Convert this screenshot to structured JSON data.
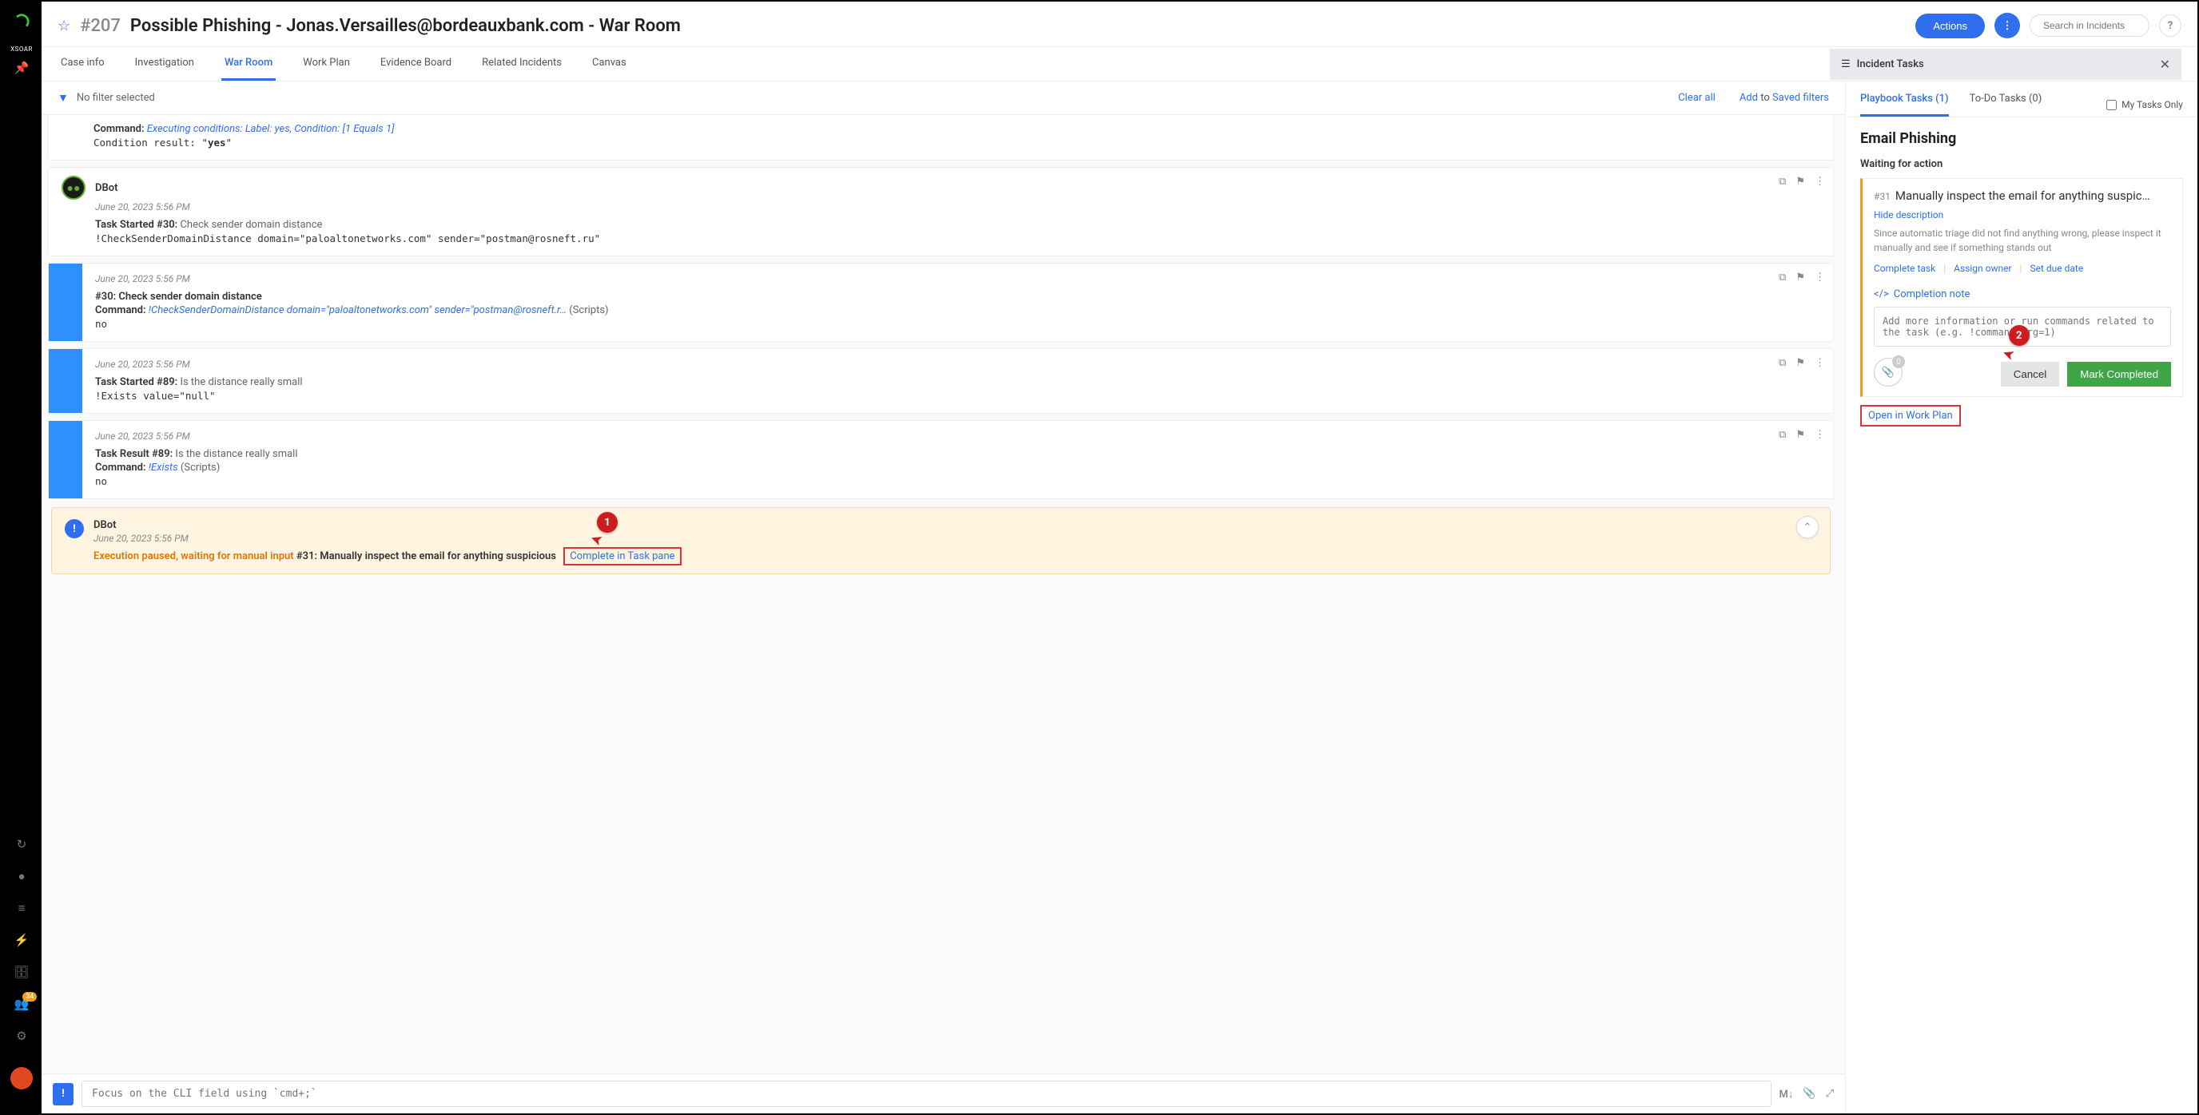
{
  "sidebar": {
    "label": "XSOAR",
    "badge": "34"
  },
  "header": {
    "id": "#207",
    "title": "Possible Phishing - Jonas.Versailles@bordeauxbank.com - War Room",
    "actions": "Actions",
    "search_placeholder": "Search in Incidents",
    "help": "?"
  },
  "tabs": [
    "Case info",
    "Investigation",
    "War Room",
    "Work Plan",
    "Evidence Board",
    "Related Incidents",
    "Canvas"
  ],
  "tasks_header": "Incident Tasks",
  "filter": {
    "none": "No filter selected",
    "clear": "Clear all",
    "add": "Add",
    "to": "to",
    "saved": "Saved filters"
  },
  "entries": {
    "e0_cmd_label": "Command:",
    "e0_cmd": "Executing conditions: Label: yes, Condition: [1 Equals 1]",
    "e0_result_label": "Condition result: \"",
    "e0_result_val": "yes",
    "e0_result_end": "\"",
    "e1_author": "DBot",
    "e1_ts": "June 20, 2023 5:56 PM",
    "e1_l1a": "Task Started  #30:",
    "e1_l1b": " Check sender domain distance",
    "e1_l2": "!CheckSenderDomainDistance domain=\"paloaltonetworks.com\" sender=\"postman@rosneft.ru\"",
    "e2_ts": "June 20, 2023 5:56 PM",
    "e2_l1": "#30: Check sender domain distance",
    "e2_cmd_label": "Command:",
    "e2_cmd": "!CheckSenderDomainDistance domain=\"paloaltonetworks.com\" sender=\"postman@rosneft.r…",
    "e2_scripts": "  (Scripts)",
    "e2_no": "no",
    "e3_ts": "June 20, 2023 5:56 PM",
    "e3_l1a": "Task Started  #89:",
    "e3_l1b": " Is the distance really small",
    "e3_l2": "!Exists value=\"null\"",
    "e4_ts": "June 20, 2023 5:56 PM",
    "e4_l1a": "Task Result  #89:",
    "e4_l1b": " Is the distance really small",
    "e4_cmd_label": "Command:",
    "e4_cmd": "!Exists",
    "e4_scripts": "  (Scripts)",
    "e4_no": "no",
    "paused_author": "DBot",
    "paused_ts": "June 20, 2023 5:56 PM",
    "paused_msg": "Execution paused, waiting for manual input",
    "paused_task": "  #31: Manually inspect the email for anything suspicious",
    "paused_link": "Complete in Task pane"
  },
  "cli": {
    "placeholder": "Focus on the CLI field using `cmd+;`",
    "md": "M↓"
  },
  "tasks": {
    "tab1": "Playbook Tasks (1)",
    "tab2": "To-Do Tasks (0)",
    "mytasks": "My Tasks Only",
    "playbook": "Email Phishing",
    "waiting": "Waiting for action",
    "num": "#31",
    "title": "Manually inspect the email for anything suspic…",
    "hide": "Hide description",
    "desc": "Since automatic triage did not find anything wrong, please inspect it manually and see if something stands out",
    "complete": "Complete task",
    "assign": "Assign owner",
    "due": "Set due date",
    "note_label": "Completion note",
    "note_placeholder": "Add more information or run commands related to the task (e.g. !command arg=1)",
    "attach_count": "0",
    "cancel": "Cancel",
    "mark": "Mark Completed",
    "open": "Open in Work Plan"
  },
  "callouts": {
    "c1": "1",
    "c2": "2"
  }
}
